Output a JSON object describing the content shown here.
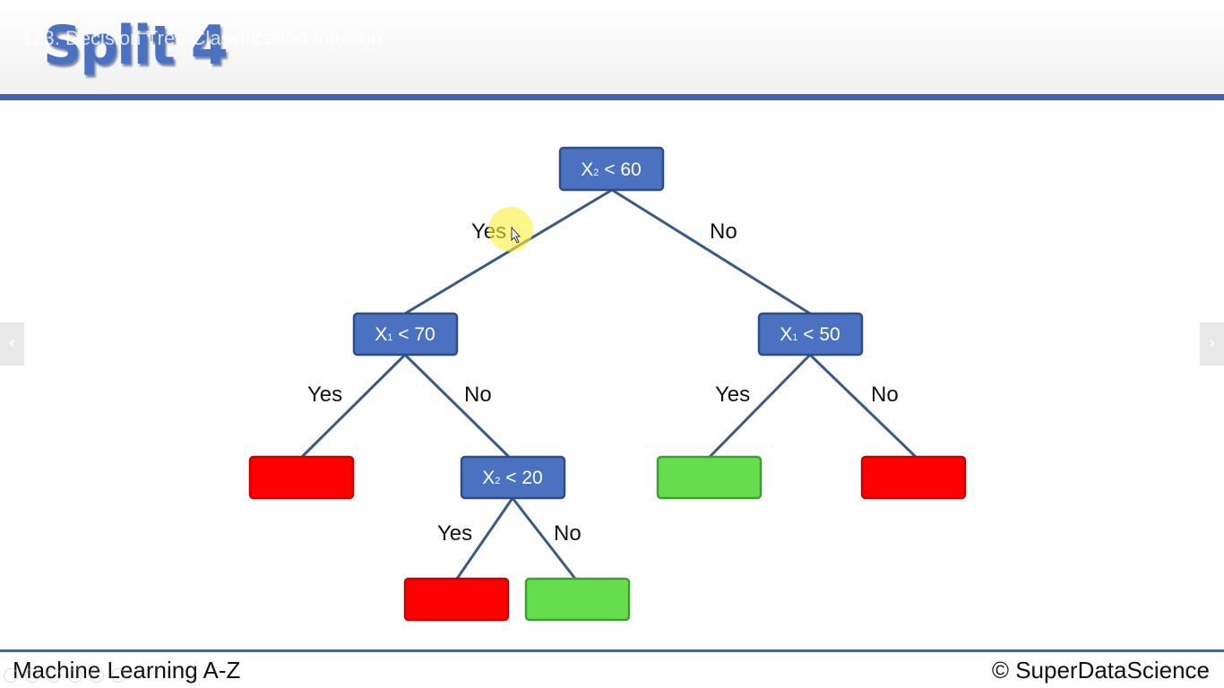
{
  "header": {
    "title": "Split 4",
    "video_title": "123. Decision Tree Classification Intuition"
  },
  "footer": {
    "left_text": "Machine Learning A-Z",
    "right_text": "© SuperDataScience"
  },
  "navigation": {
    "prev_glyph": "‹",
    "next_glyph": "›"
  },
  "colors": {
    "accent": "#3e63b3",
    "node": "#4a72c0",
    "leaf_red": "#ff0000",
    "leaf_green": "#66dd4d"
  },
  "tree": {
    "root": {
      "var": "X",
      "sub": "2",
      "cond": " < 60"
    },
    "left": {
      "var": "X",
      "sub": "1",
      "cond": " < 70"
    },
    "right": {
      "var": "X",
      "sub": "1",
      "cond": " < 50"
    },
    "left_no": {
      "var": "X",
      "sub": "2",
      "cond": " < 20"
    },
    "leaves": {
      "left_yes": "red",
      "left_no_yes": "red",
      "left_no_no": "green",
      "right_yes": "green",
      "right_no": "red"
    },
    "edge_labels": {
      "root_yes": "Yes",
      "root_no": "No",
      "left_yes": "Yes",
      "left_no": "No",
      "right_yes": "Yes",
      "right_no": "No",
      "left_no_yes": "Yes",
      "left_no_no": "No"
    }
  }
}
